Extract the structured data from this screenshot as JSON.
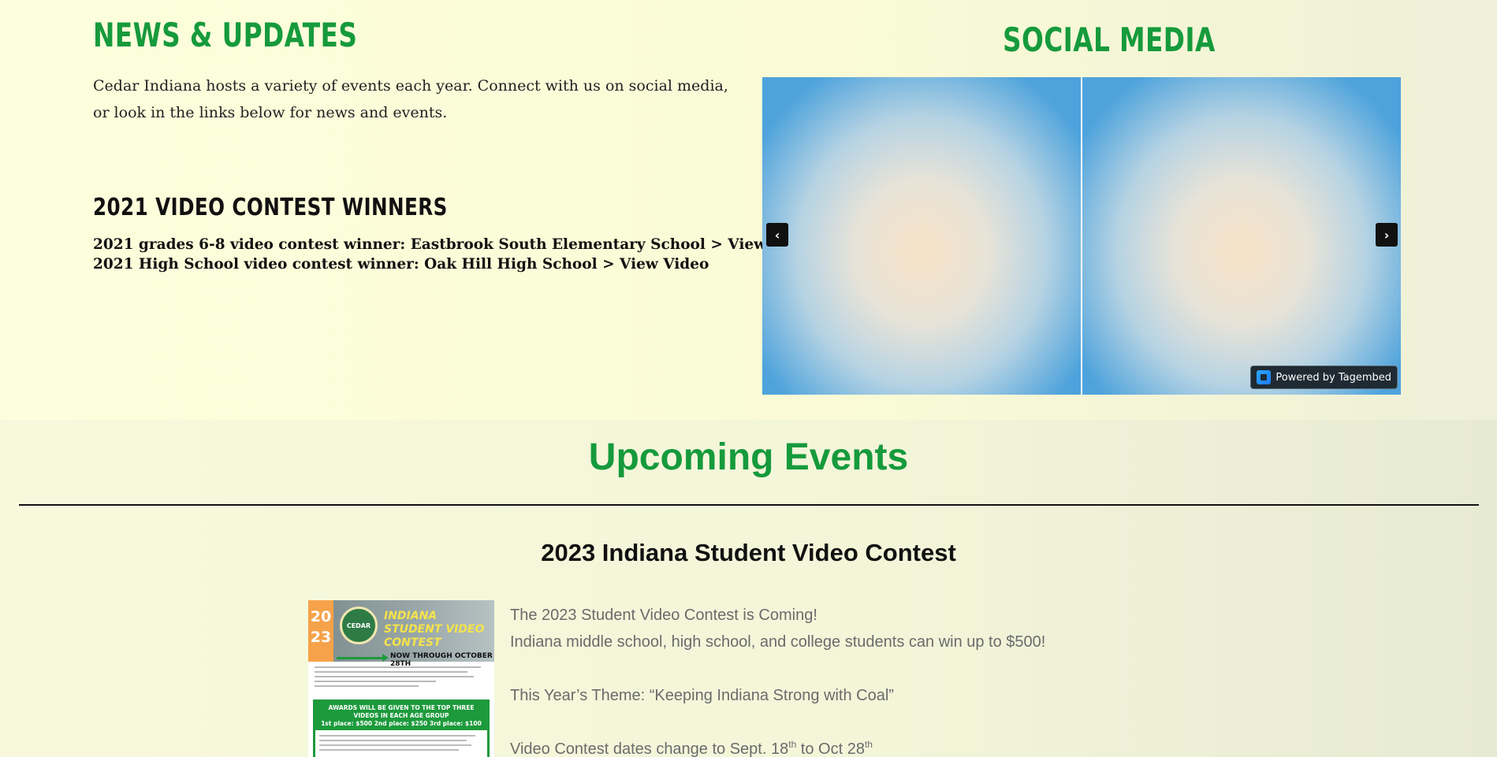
{
  "news": {
    "heading": "News & Updates",
    "body": "Cedar Indiana hosts a variety of events each year. Connect with us on social media, or look in the links below for news and events.",
    "winners_heading": "2021 Video Contest Winners",
    "winners": [
      {
        "prefix": "2021 grades 6-8 video contest winner: Eastbrook South Elementary School ",
        "link": "> View Video"
      },
      {
        "prefix": "2021 High School video contest winner: Oak Hill High School ",
        "link": "> View Video"
      }
    ]
  },
  "social": {
    "heading": "Social Media",
    "prev_icon": "chevron-left-icon",
    "next_icon": "chevron-right-icon",
    "prev_glyph": "‹",
    "next_glyph": "›",
    "powered_label": "Powered by Tagembed"
  },
  "events": {
    "heading": "Upcoming Events",
    "event_title": "2023 Indiana Student Video Contest",
    "flyer": {
      "year_top": "20",
      "year_bottom": "23",
      "seal": "CEDAR",
      "title": "Indiana Student Video Contest",
      "date": "NOW THROUGH OCTOBER 28TH",
      "awards_head": "AWARDS WILL BE GIVEN TO THE TOP THREE VIDEOS IN EACH AGE GROUP",
      "awards_prizes": "1st place: $500   2nd place: $250   3rd place: $100"
    },
    "lines": {
      "line1": "The 2023 Student Video Contest is Coming!",
      "line2": "Indiana middle school, high school, and college students can win up to $500!",
      "line3": "This Year’s Theme: “Keeping Indiana Strong with Coal”",
      "line4_a": "Video Contest dates change to Sept. 18",
      "line4_sup1": "th",
      "line4_b": " to Oct 28",
      "line4_sup2": "th"
    }
  },
  "colors": {
    "brand_green": "#169a3c",
    "background": "#fafbd6"
  }
}
